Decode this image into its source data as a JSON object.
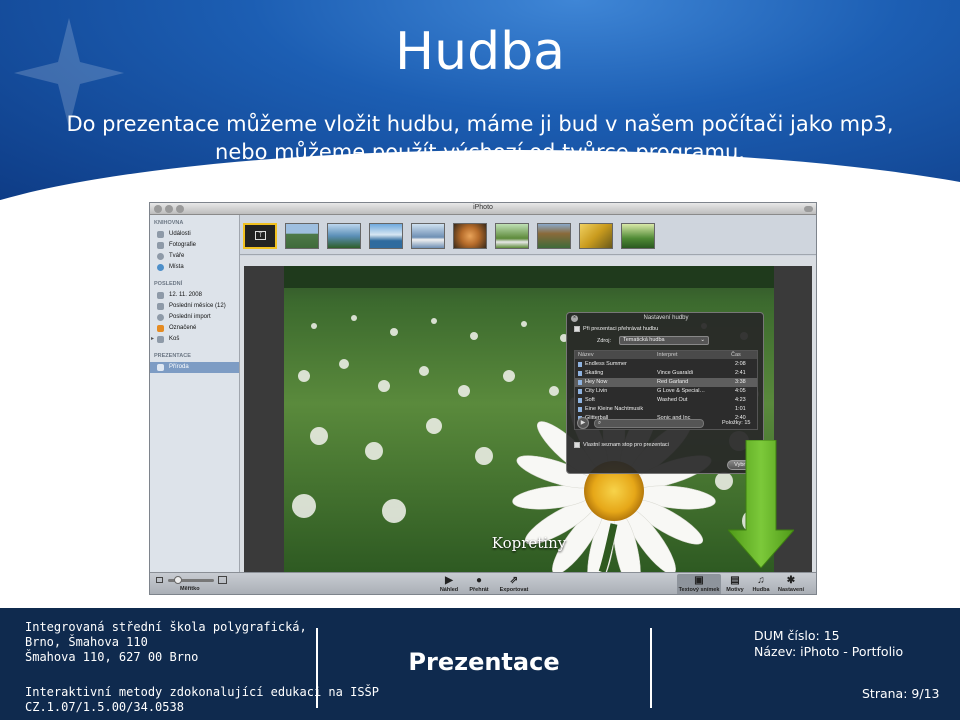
{
  "slide": {
    "title": "Hudba",
    "body_line1": "Do prezentace můžeme vložit hudbu, máme ji bud v našem počítači jako mp3,",
    "body_line2": "nebo můžeme použít výchozí od tvůrce programu."
  },
  "iphoto": {
    "window_title": "iPhoto",
    "sidebar": {
      "sections": [
        {
          "title": "KNIHOVNA",
          "items": [
            {
              "label": "Události",
              "icon": "events-icon"
            },
            {
              "label": "Fotografie",
              "icon": "photos-icon"
            },
            {
              "label": "Tváře",
              "icon": "faces-icon"
            },
            {
              "label": "Místa",
              "icon": "places-icon"
            }
          ]
        },
        {
          "title": "POSLEDNÍ",
          "items": [
            {
              "label": "12. 11. 2008",
              "icon": "event-icon"
            },
            {
              "label": "Poslední měsíce (12)",
              "icon": "calendar-icon"
            },
            {
              "label": "Poslední import",
              "icon": "import-icon"
            },
            {
              "label": "Označené",
              "icon": "flag-icon"
            },
            {
              "label": "Koš",
              "icon": "trash-icon"
            }
          ]
        },
        {
          "title": "PREZENTACE",
          "items": [
            {
              "label": "Příroda",
              "icon": "slideshow-icon",
              "selected": true
            }
          ]
        }
      ]
    },
    "thumbnails": [
      {
        "color": "#1b1b1b",
        "selected": true
      },
      {
        "color": "#4e7a4a"
      },
      {
        "color": "#5b8fb7"
      },
      {
        "color": "#2f6b9e"
      },
      {
        "color": "#6e8fb4"
      },
      {
        "color": "#b56b2a"
      },
      {
        "color": "#5d8a3a"
      },
      {
        "color": "#8a6a3a"
      },
      {
        "color": "#c99b1e"
      },
      {
        "color": "#4f8a35"
      }
    ],
    "photo_caption": "Kopretiny",
    "music_panel": {
      "title": "Nastavení hudby",
      "play_label": "Při prezentaci přehrávat hudbu",
      "source_label": "Zdroj:",
      "source_value": "Tematická hudba",
      "columns": [
        "Název",
        "Interpret",
        "Čas"
      ],
      "tracks": [
        {
          "name": "Endless Summer",
          "artist": "",
          "time": "2:08"
        },
        {
          "name": "Skating",
          "artist": "Vince Guaraldi",
          "time": "2:41"
        },
        {
          "name": "Hey Now",
          "artist": "Red Garland",
          "time": "3:38",
          "selected": true
        },
        {
          "name": "City Livin",
          "artist": "G Love & Special…",
          "time": "4:05"
        },
        {
          "name": "Soft",
          "artist": "Washed Out",
          "time": "4:23"
        },
        {
          "name": "Eine Kleine Nachtmusik",
          "artist": "",
          "time": "1:01"
        },
        {
          "name": "Glitterball",
          "artist": "Sonic and Inc",
          "time": "2:40"
        }
      ],
      "count_label": "Položky: 15",
      "custom_label": "Vlastní seznam stop pro prezentaci",
      "choose_button": "Vybrat"
    },
    "toolbar": {
      "scale_label": "Měřítko",
      "preview_label": "Náhled",
      "play_label": "Přehrát",
      "export_label": "Exportovat",
      "text_slide_label": "Textový snímek",
      "themes_label": "Motivy",
      "music_label": "Hudba",
      "settings_label": "Nastavení"
    },
    "colors": {
      "arrow": "#6ab521",
      "accent_selected": "#7d9cc4"
    }
  },
  "footer": {
    "school_line1": "Integrovaná střední škola polygrafická,",
    "school_line2": "Brno, Šmahova 110",
    "school_line3": "Šmahova 110, 627 00 Brno",
    "program_line1": "Interaktivní metody zdokonalující edukaci na ISŠP",
    "program_line2": "CZ.1.07/1.5.00/34.0538",
    "center_title": "Prezentace",
    "dum": "DUM číslo: 15",
    "name": "Název: iPhoto - Portfolio",
    "page": "Strana: 9/13"
  }
}
